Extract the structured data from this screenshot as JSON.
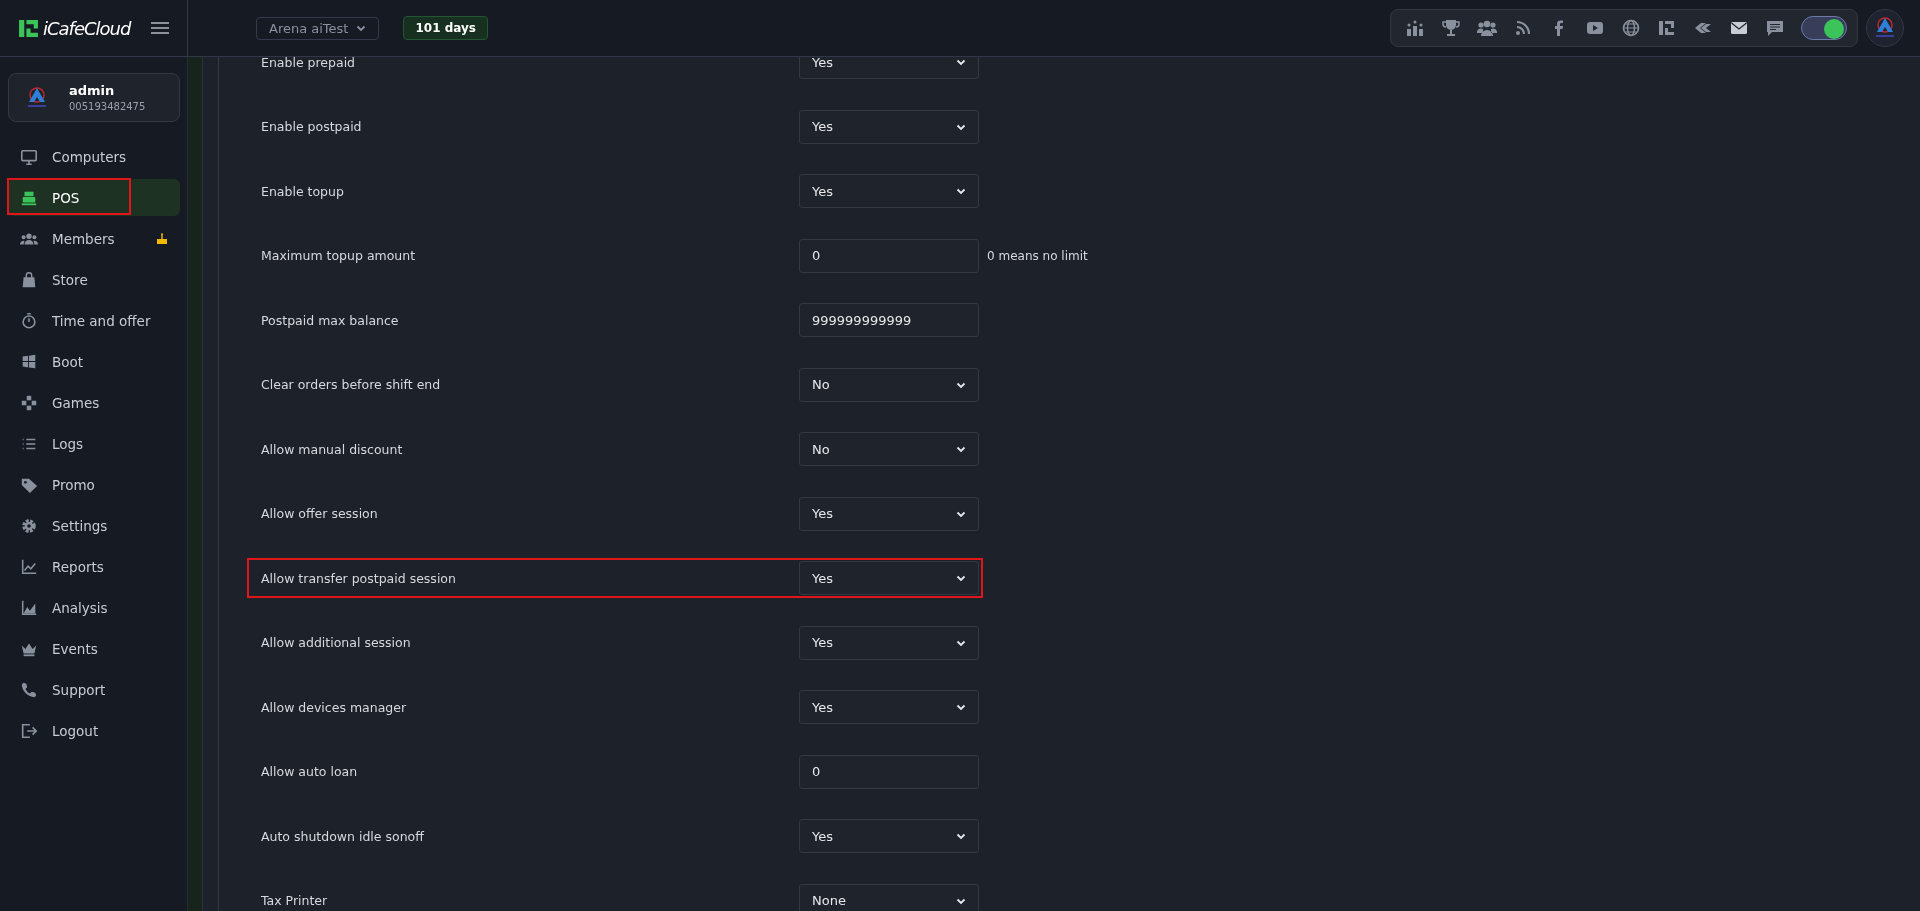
{
  "brand": {
    "name": "iCafeCloud"
  },
  "topbar": {
    "cafe_selector": "Arena aiTest",
    "days_badge": "101 days",
    "theme_toggle": {
      "on": true
    }
  },
  "profile": {
    "name": "admin",
    "account_id": "005193482475"
  },
  "sidebar": {
    "items": [
      {
        "label": "Computers",
        "kind": "monitor",
        "selected": false,
        "highlighted": false,
        "birthday": false
      },
      {
        "label": "POS",
        "kind": "register",
        "selected": true,
        "highlighted": true,
        "birthday": false
      },
      {
        "label": "Members",
        "kind": "people",
        "selected": false,
        "highlighted": false,
        "birthday": true
      },
      {
        "label": "Store",
        "kind": "bag",
        "selected": false,
        "highlighted": false,
        "birthday": false
      },
      {
        "label": "Time and offer",
        "kind": "timer",
        "selected": false,
        "highlighted": false,
        "birthday": false
      },
      {
        "label": "Boot",
        "kind": "windows",
        "selected": false,
        "highlighted": false,
        "birthday": false
      },
      {
        "label": "Games",
        "kind": "gamepad",
        "selected": false,
        "highlighted": false,
        "birthday": false
      },
      {
        "label": "Logs",
        "kind": "list",
        "selected": false,
        "highlighted": false,
        "birthday": false
      },
      {
        "label": "Promo",
        "kind": "tag",
        "selected": false,
        "highlighted": false,
        "birthday": false
      },
      {
        "label": "Settings",
        "kind": "gear",
        "selected": false,
        "highlighted": false,
        "birthday": false
      },
      {
        "label": "Reports",
        "kind": "line",
        "selected": false,
        "highlighted": false,
        "birthday": false
      },
      {
        "label": "Analysis",
        "kind": "area",
        "selected": false,
        "highlighted": false,
        "birthday": false
      },
      {
        "label": "Events",
        "kind": "crown",
        "selected": false,
        "highlighted": false,
        "birthday": false
      },
      {
        "label": "Support",
        "kind": "phone",
        "selected": false,
        "highlighted": false,
        "birthday": false
      },
      {
        "label": "Logout",
        "kind": "logout",
        "selected": false,
        "highlighted": false,
        "birthday": false
      }
    ]
  },
  "settings": [
    {
      "label": "Enable prepaid",
      "kind": "select",
      "value": "Yes",
      "highlighted": false
    },
    {
      "label": "Enable postpaid",
      "kind": "select",
      "value": "Yes",
      "highlighted": false
    },
    {
      "label": "Enable topup",
      "kind": "select",
      "value": "Yes",
      "highlighted": false
    },
    {
      "label": "Maximum topup amount",
      "kind": "input",
      "value": "0",
      "hint": "0 means no limit",
      "highlighted": false
    },
    {
      "label": "Postpaid max balance",
      "kind": "input",
      "value": "999999999999",
      "highlighted": false
    },
    {
      "label": "Clear orders before shift end",
      "kind": "select",
      "value": "No",
      "highlighted": false
    },
    {
      "label": "Allow manual discount",
      "kind": "select",
      "value": "No",
      "highlighted": false
    },
    {
      "label": "Allow offer session",
      "kind": "select",
      "value": "Yes",
      "highlighted": false
    },
    {
      "label": "Allow transfer postpaid session",
      "kind": "select",
      "value": "Yes",
      "highlighted": true
    },
    {
      "label": "Allow additional session",
      "kind": "select",
      "value": "Yes",
      "highlighted": false
    },
    {
      "label": "Allow devices manager",
      "kind": "select",
      "value": "Yes",
      "highlighted": false
    },
    {
      "label": "Allow auto loan",
      "kind": "input",
      "value": "0",
      "highlighted": false
    },
    {
      "label": "Auto shutdown idle sonoff",
      "kind": "select",
      "value": "Yes",
      "highlighted": false
    },
    {
      "label": "Tax Printer",
      "kind": "select",
      "value": "None",
      "highlighted": false
    }
  ]
}
